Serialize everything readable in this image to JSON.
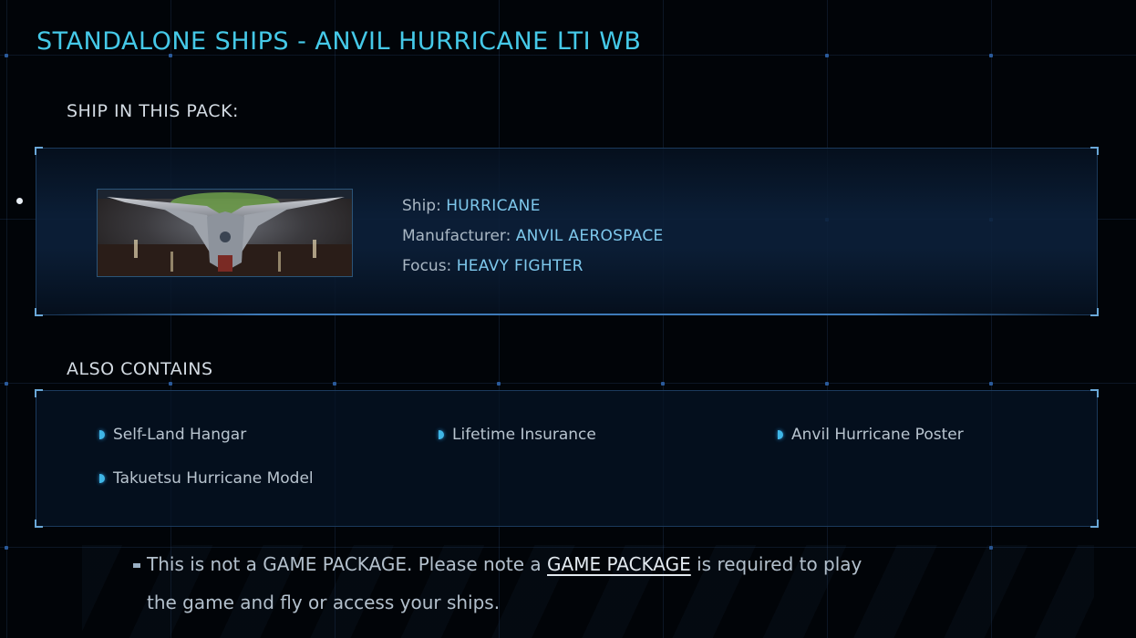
{
  "page": {
    "title": "STANDALONE SHIPS - ANVIL HURRICANE LTI WB"
  },
  "ship_section": {
    "heading": "SHIP IN THIS PACK:",
    "image_icon": "ship-thumbnail",
    "ship_label": "Ship:",
    "ship_value": "HURRICANE",
    "manufacturer_label": "Manufacturer:",
    "manufacturer_value": "ANVIL AEROSPACE",
    "focus_label": "Focus:",
    "focus_value": "HEAVY FIGHTER"
  },
  "contains_section": {
    "heading": "ALSO CONTAINS",
    "items": [
      {
        "label": "Self-Land Hangar"
      },
      {
        "label": "Lifetime Insurance"
      },
      {
        "label": "Anvil Hurricane Poster"
      },
      {
        "label": "Takuetsu Hurricane Model"
      }
    ]
  },
  "notice": {
    "line1_before": "This is not a GAME PACKAGE. Please note a",
    "link_text": "GAME PACKAGE",
    "line1_after": "is required to play",
    "line2": "the game and fly or access your ships."
  },
  "colors": {
    "title": "#45c9e8",
    "value": "#7ec8ec",
    "accent": "#3fb6e6",
    "panel_border": "#1b3a5c"
  }
}
